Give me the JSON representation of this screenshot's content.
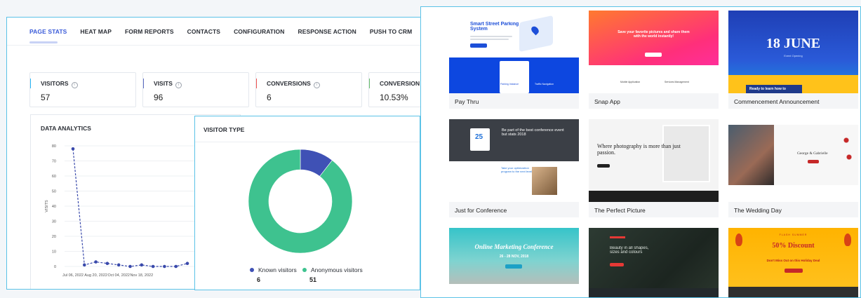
{
  "tabs": [
    {
      "label": "PAGE STATS",
      "active": true
    },
    {
      "label": "HEAT MAP",
      "active": false
    },
    {
      "label": "FORM REPORTS",
      "active": false
    },
    {
      "label": "CONTACTS",
      "active": false
    },
    {
      "label": "CONFIGURATION",
      "active": false
    },
    {
      "label": "RESPONSE ACTION",
      "active": false
    },
    {
      "label": "PUSH TO CRM",
      "active": false
    }
  ],
  "stats": [
    {
      "label": "VISITORS",
      "value": "57",
      "color": "#29b6f6"
    },
    {
      "label": "VISITS",
      "value": "96",
      "color": "#5c6bc0"
    },
    {
      "label": "CONVERSIONS",
      "value": "6",
      "color": "#ef5350"
    },
    {
      "label": "CONVERSION R",
      "value": "10.53%",
      "color": "#66bb6a"
    }
  ],
  "info_glyph": "i",
  "data_analytics": {
    "title": "DATA ANALYTICS",
    "chart_data": {
      "type": "line",
      "ylabel": "VISITS",
      "xlabel": "",
      "ylim": [
        0,
        80
      ],
      "yticks": [
        0,
        10,
        20,
        30,
        40,
        50,
        60,
        70,
        80
      ],
      "xtick_labels": [
        "Jul 06, 2022",
        "Aug 20, 2022",
        "Oct 04, 2022",
        "Nov 18, 2022"
      ],
      "series": [
        {
          "color": "#3949ab",
          "values": [
            78,
            1,
            3,
            2,
            1,
            0,
            1,
            0,
            0,
            0,
            2
          ]
        }
      ],
      "grid": true
    }
  },
  "visitor_type": {
    "title": "VISITOR TYPE",
    "chart_data": {
      "type": "pie",
      "donut": true,
      "categories": [
        "Known visitors",
        "Anonymous visitors"
      ],
      "values": [
        6,
        51
      ],
      "colors": [
        "#3f51b5",
        "#3ec28f"
      ]
    },
    "legend": [
      {
        "label": "Known visitors",
        "value": "6",
        "color": "#3f51b5"
      },
      {
        "label": "Anonymous visitors",
        "value": "51",
        "color": "#3ec28f"
      }
    ]
  },
  "templates": [
    {
      "name": "Pay Thru",
      "thumb_heading": "Smart Street Parking System",
      "sub": [
        "Parking Instance",
        "Traffic Navigation"
      ]
    },
    {
      "name": "Snap App",
      "thumb_heading": "Save your favorite pictures and share them with the world instantly!",
      "sub": [
        "Mobile Application",
        "Services Management"
      ]
    },
    {
      "name": "Commencement Announcement",
      "thumb_heading": "18 JUNE",
      "sub": [
        "Event Opening",
        "Ready to learn how to"
      ]
    },
    {
      "name": "Just for Conference",
      "thumb_heading": "Be part of the best conference event but stats 2018",
      "sub": [
        "25",
        "Take your optimization program to the next level"
      ]
    },
    {
      "name": "The Perfect Picture",
      "thumb_heading": "Where photography is more than just passion.",
      "sub": []
    },
    {
      "name": "The Wedding Day",
      "thumb_heading": "George & Gabrielle",
      "sub": []
    },
    {
      "name": "",
      "thumb_heading": "Online Marketing Conference",
      "sub": [
        "26 - 28 NOV, 2018"
      ]
    },
    {
      "name": "",
      "thumb_heading": "Beauty in all shapes, sizes and colours",
      "sub": []
    },
    {
      "name": "",
      "thumb_heading": "50% Discount",
      "sub": [
        "FLASH SUMMER",
        "Don't Miss Out on this Holiday Deal"
      ]
    }
  ]
}
